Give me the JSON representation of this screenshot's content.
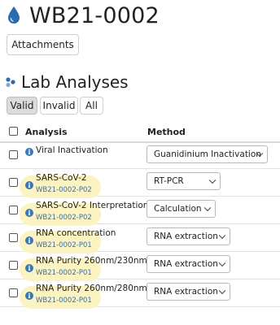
{
  "sample": {
    "id": "WB21-0002",
    "icon": "water-drop-icon"
  },
  "toolbar": {
    "attachments_label": "Attachments"
  },
  "section": {
    "title": "Lab Analyses",
    "icon": "cluster-icon"
  },
  "filters": [
    {
      "label": "Valid",
      "active": true
    },
    {
      "label": "Invalid",
      "active": false
    },
    {
      "label": "All",
      "active": false
    }
  ],
  "table": {
    "columns": [
      "Analysis",
      "Method"
    ],
    "rows": [
      {
        "name": "Viral Inactivation",
        "sample": "",
        "method": "Guanidinium Inactivation"
      },
      {
        "name": "SARS-CoV-2",
        "sample": "WB21-0002-P02",
        "method": "RT-PCR"
      },
      {
        "name": "SARS-CoV-2 Interpretation",
        "sample": "WB21-0002-P02",
        "method": "Calculation"
      },
      {
        "name": "RNA concentration",
        "sample": "WB21-0002-P01",
        "method": "RNA extraction"
      },
      {
        "name": "RNA Purity 260nm/230nm",
        "sample": "WB21-0002-P01",
        "method": "RNA extraction"
      },
      {
        "name": "RNA Purity 260nm/280nm",
        "sample": "WB21-0002-P01",
        "method": "RNA extraction"
      }
    ]
  },
  "colors": {
    "accent": "#2a6bb0",
    "link": "#3a6fa5",
    "highlight": "#fbf3c1"
  }
}
